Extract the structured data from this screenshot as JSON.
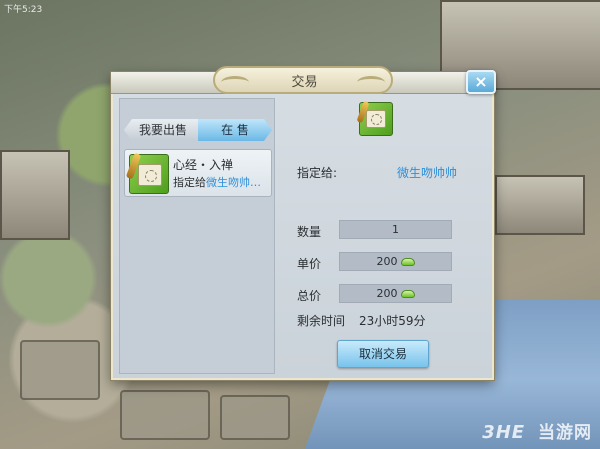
{
  "status_bar": {
    "time": "下午5:23"
  },
  "dialog": {
    "title": "交易",
    "close_label": "×"
  },
  "tabs": [
    {
      "label": "我要出售",
      "active": false
    },
    {
      "label": "在 售",
      "active": true
    }
  ],
  "listing": {
    "name": "心经・入禅",
    "target_prefix": "指定给",
    "target_player": "微生吻帅…"
  },
  "detail": {
    "target_label": "指定给:",
    "target_value": "微生吻帅帅",
    "quantity_label": "数量",
    "quantity_value": "1",
    "unit_price_label": "单价",
    "unit_price_value": "200",
    "total_price_label": "总价",
    "total_price_value": "200",
    "remaining_label": "剩余时间",
    "remaining_value": "23小时59分",
    "cancel_button": "取消交易"
  },
  "watermark": {
    "brand": "3HE",
    "text": "当游网"
  },
  "colors": {
    "accent_blue": "#2f8fd8",
    "button_blue": "#78c3ec",
    "icon_green": "#4e9e1e"
  },
  "icons": [
    "close-icon",
    "skill-book-icon",
    "currency-ingot-icon"
  ]
}
